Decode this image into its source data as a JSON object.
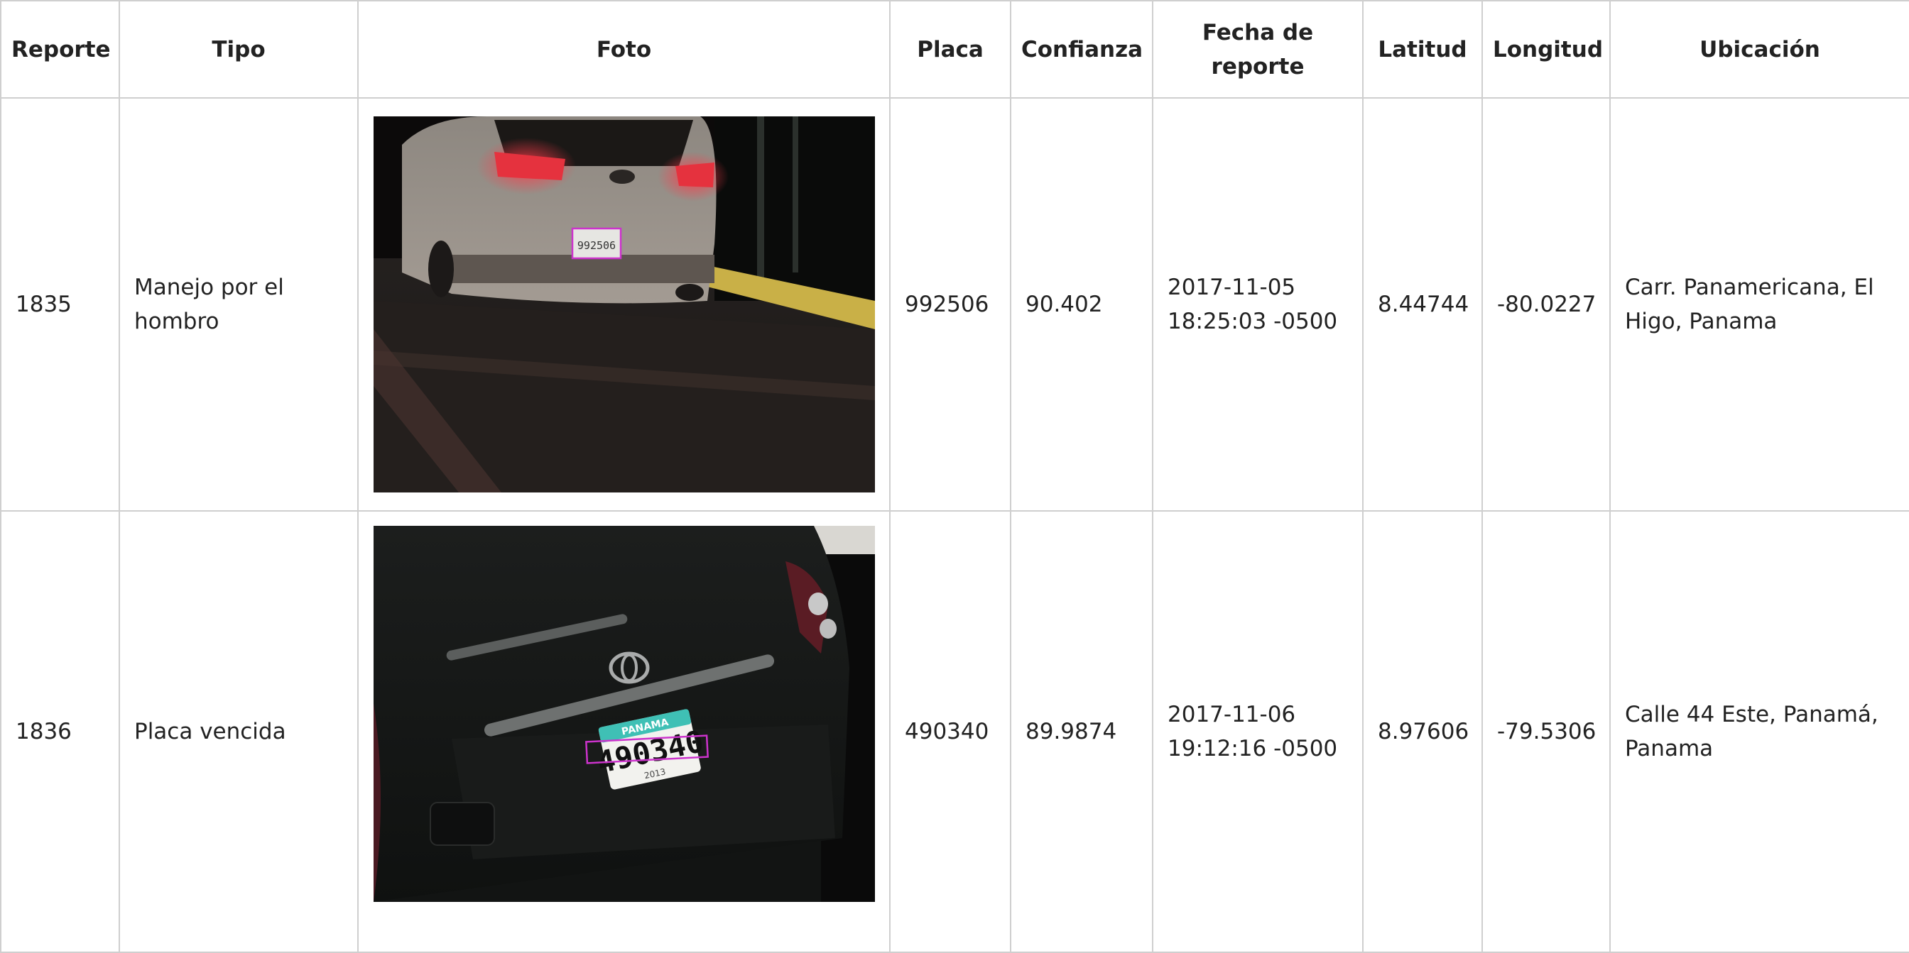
{
  "table": {
    "headers": [
      "Reporte",
      "Tipo",
      "Foto",
      "Placa",
      "Confianza",
      "Fecha de reporte",
      "Latitud",
      "Longitud",
      "Ubicación"
    ],
    "rows": [
      {
        "reporte": "1835",
        "tipo": "Manejo por el hombro",
        "foto_plate_text": "992506",
        "placa": "992506",
        "confianza": "90.402",
        "fecha": "2017-11-05 18:25:03 -0500",
        "latitud": "8.44744",
        "longitud": "-80.0227",
        "ubicacion": "Carr. Panamericana, El Higo, Panama"
      },
      {
        "reporte": "1836",
        "tipo": "Placa vencida",
        "foto_plate_text": "490340",
        "foto_plate_header": "PANAMA",
        "foto_plate_year": "2013",
        "placa": "490340",
        "confianza": "89.9874",
        "fecha": "2017-11-06 19:12:16 -0500",
        "latitud": "8.97606",
        "longitud": "-79.5306",
        "ubicacion": "Calle 44 Este, Panamá, Panama"
      }
    ]
  }
}
